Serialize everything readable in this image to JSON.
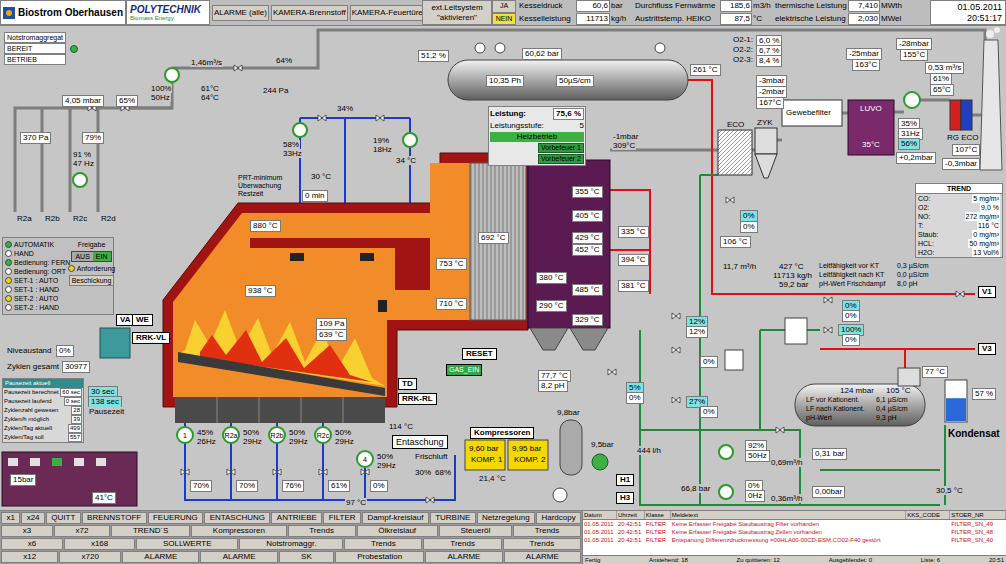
{
  "header": {
    "site": "Biostrom Oberhausen",
    "brand": {
      "name": "POLYTECHNIK",
      "tagline": "Biomass Energy"
    },
    "buttons": [
      "ALARME (alle)",
      "KAMERA-Brennstoff",
      "KAMERA-Feuertüre-1"
    ],
    "ext": {
      "label": "ext.Leitsystem",
      "action": "\"aktivieren\"",
      "options": [
        {
          "label": "JA",
          "selected": false
        },
        {
          "label": "NEIN",
          "selected": true
        }
      ]
    },
    "readings": [
      [
        {
          "label": "Kesseldruck",
          "value": "60,6",
          "unit": "bar"
        },
        {
          "label": "Kesselleistung",
          "value": "11713",
          "unit": "kg/h"
        }
      ],
      [
        {
          "label": "Durchfluss Fernwärme",
          "value": "185,6",
          "unit": "m3/h"
        },
        {
          "label": "Austrittstemp. HEIKO",
          "value": "87,5",
          "unit": "°C"
        }
      ],
      [
        {
          "label": "thermische Leistung",
          "value": "7,410",
          "unit": "MWth"
        },
        {
          "label": "elektrische Leistung",
          "value": "2,030",
          "unit": "MWel"
        }
      ]
    ],
    "date": "01.05.2011",
    "time": "20:51:17"
  },
  "emergency": {
    "title": "Notstromaggregat",
    "states": [
      {
        "label": "BEREIT",
        "on": true
      },
      {
        "label": "BETRIEB",
        "on": false
      }
    ]
  },
  "power": {
    "label": "Leistung:",
    "value": "75,6 %",
    "stage_label": "Leistungsstufe:",
    "stage": "5",
    "mode": "Heizbetrieb",
    "buttons": [
      "Vorbefeuer 1",
      "Vorbefeuer 2"
    ]
  },
  "mode": {
    "options": [
      {
        "label": "AUTOMATIK",
        "selected": true,
        "color": "#2fb34a"
      },
      {
        "label": "HAND",
        "selected": false,
        "color": "#ffffff"
      },
      {
        "label": "Bedienung: FERN",
        "selected": true,
        "color": "#2fb34a"
      },
      {
        "label": "Bedienung: ORT",
        "selected": false,
        "color": "#ffffff"
      },
      {
        "label": "SET-1 : AUTO",
        "selected": true,
        "color": "#e8d52a"
      },
      {
        "label": "SET-1 : HAND",
        "selected": false,
        "color": "#ffffff"
      },
      {
        "label": "SET-2 : AUTO",
        "selected": true,
        "color": "#e8d52a"
      },
      {
        "label": "SET-2 : HAND",
        "selected": false,
        "color": "#ffffff"
      }
    ],
    "release_label": "Freigabe",
    "release": [
      {
        "label": "AUS",
        "selected": false
      },
      {
        "label": "EIN",
        "selected": true
      }
    ],
    "request": {
      "label": "Anforderung",
      "on": true
    },
    "button": "Beschickung"
  },
  "cycles": {
    "title": "Pausezeit aktuell",
    "rows": [
      {
        "label": "Pausezeit berechnet",
        "value": "60 sec"
      },
      {
        "label": "Pausezeit laufend",
        "value": "0 sec"
      },
      {
        "label": "Zyklenzahl gewesen",
        "value": "28"
      },
      {
        "label": "Zyklen/h möglich",
        "value": "39"
      },
      {
        "label": "Zyklen/Tag aktuell",
        "value": "499"
      },
      {
        "label": "Zyklen/Tag soll",
        "value": "557"
      }
    ]
  },
  "trend": {
    "title": "TREND",
    "rows": [
      {
        "label": "CO:",
        "value": "5 mg/m³"
      },
      {
        "label": "O2:",
        "value": "9,0 %"
      },
      {
        "label": "NO:",
        "value": "272 mg/m³"
      },
      {
        "label": "T:",
        "value": "116 °C"
      },
      {
        "label": "Staub:",
        "value": "0 mg/m³"
      },
      {
        "label": "HCL:",
        "value": "50 mg/m³"
      },
      {
        "label": "H2O:",
        "value": "13 Vol%"
      }
    ]
  },
  "condensate": {
    "level": 0.57
  },
  "diagram": {
    "labels": [
      {
        "text": "1,46m³/s",
        "kind": "plain"
      },
      {
        "text": "4,05 mbar",
        "kind": "box"
      },
      {
        "text": "65%",
        "kind": "box"
      },
      {
        "text": "370 Pa",
        "kind": "box"
      },
      {
        "text": "79%",
        "kind": "box"
      },
      {
        "text": "91 %",
        "kind": "plain"
      },
      {
        "text": "47 Hz",
        "kind": "plain"
      },
      {
        "text": "100%",
        "kind": "plain"
      },
      {
        "text": "50Hz",
        "kind": "plain"
      },
      {
        "text": "61°C",
        "kind": "plain"
      },
      {
        "text": "64°C",
        "kind": "plain"
      },
      {
        "text": "64%",
        "kind": "plain"
      },
      {
        "text": "244 Pa",
        "kind": "plain"
      },
      {
        "text": "34%",
        "kind": "plain"
      },
      {
        "text": "19%",
        "kind": "plain"
      },
      {
        "text": "18Hz",
        "kind": "plain"
      },
      {
        "text": "34 °C",
        "kind": "plain"
      },
      {
        "text": "58%",
        "kind": "plain"
      },
      {
        "text": "33Hz",
        "kind": "plain"
      },
      {
        "text": "30 °C",
        "kind": "plain"
      },
      {
        "text": "R2a",
        "kind": "plain"
      },
      {
        "text": "R2b",
        "kind": "plain"
      },
      {
        "text": "R2c",
        "kind": "plain"
      },
      {
        "text": "R2d",
        "kind": "plain"
      },
      {
        "text": "PRT-minimum Überwachung Restzeit",
        "kind": "note"
      },
      {
        "text": "0 min",
        "kind": "box"
      },
      {
        "text": "880 °C",
        "kind": "box"
      },
      {
        "text": "938 °C",
        "kind": "box"
      },
      {
        "text": "753 °C",
        "kind": "box"
      },
      {
        "text": "692 °C",
        "kind": "box"
      },
      {
        "text": "710 °C",
        "kind": "box"
      },
      {
        "text": "109 Pa",
        "kind": "box"
      },
      {
        "text": "639 °C",
        "kind": "box"
      },
      {
        "text": "51,2 %",
        "kind": "box"
      },
      {
        "text": "60,62 bar",
        "kind": "box"
      },
      {
        "text": "10,35 Ph",
        "kind": "box"
      },
      {
        "text": "50µS/cm",
        "kind": "box"
      },
      {
        "text": "-1mbar",
        "kind": "plain"
      },
      {
        "text": "309°C",
        "kind": "plain"
      },
      {
        "text": "355 °C",
        "kind": "box"
      },
      {
        "text": "405 °C",
        "kind": "box"
      },
      {
        "text": "429 °C",
        "kind": "box"
      },
      {
        "text": "452 °C",
        "kind": "box"
      },
      {
        "text": "380 °C",
        "kind": "box"
      },
      {
        "text": "485 °C",
        "kind": "box"
      },
      {
        "text": "290 °C",
        "kind": "box"
      },
      {
        "text": "329 °C",
        "kind": "box"
      },
      {
        "text": "335 °C",
        "kind": "box"
      },
      {
        "text": "394 °C",
        "kind": "box"
      },
      {
        "text": "381 °C",
        "kind": "box"
      },
      {
        "text": "261 °C",
        "kind": "box"
      },
      {
        "text": "106 °C",
        "kind": "box"
      },
      {
        "text": "11,7 m³/h",
        "kind": "plain"
      },
      {
        "text": "0%",
        "kind": "cyan"
      },
      {
        "text": "0%",
        "kind": "box"
      },
      {
        "text": "427 °C",
        "kind": "plain"
      },
      {
        "text": "11713 kg/h",
        "kind": "plain"
      },
      {
        "text": "59,2 bar",
        "kind": "plain"
      },
      {
        "text": "O2-1:",
        "kind": "plain"
      },
      {
        "text": "6,0 %",
        "kind": "box"
      },
      {
        "text": "O2-2:",
        "kind": "plain"
      },
      {
        "text": "6,7 %",
        "kind": "box"
      },
      {
        "text": "O2-3:",
        "kind": "plain"
      },
      {
        "text": "8,4 %",
        "kind": "box"
      },
      {
        "text": "-3mbar",
        "kind": "box"
      },
      {
        "text": "-2mbar",
        "kind": "box"
      },
      {
        "text": "167°C",
        "kind": "box"
      },
      {
        "text": "ECO",
        "kind": "plain"
      },
      {
        "text": "ZYK",
        "kind": "plain"
      },
      {
        "text": "Gewebefilter",
        "kind": "wbox"
      },
      {
        "text": "LUVO",
        "kind": "inv"
      },
      {
        "text": "-25mbar",
        "kind": "box"
      },
      {
        "text": "163°C",
        "kind": "box"
      },
      {
        "text": "-28mbar",
        "kind": "box"
      },
      {
        "text": "155°C",
        "kind": "box"
      },
      {
        "text": "0,53 m³/s",
        "kind": "box"
      },
      {
        "text": "61%",
        "kind": "box"
      },
      {
        "text": "65°C",
        "kind": "box"
      },
      {
        "text": "35%",
        "kind": "box"
      },
      {
        "text": "31Hz",
        "kind": "box"
      },
      {
        "text": "56%",
        "kind": "cyan"
      },
      {
        "text": "35°C",
        "kind": "inv"
      },
      {
        "text": "RG ECO",
        "kind": "plain"
      },
      {
        "text": "+0,2mbar",
        "kind": "box"
      },
      {
        "text": "107°C",
        "kind": "box"
      },
      {
        "text": "-0,3mbar",
        "kind": "box"
      },
      {
        "text": "Leitfähigkeit vor KT",
        "kind": "small"
      },
      {
        "text": "0,3 µS/cm",
        "kind": "small"
      },
      {
        "text": "Leitfähigkeit nach KT",
        "kind": "small"
      },
      {
        "text": "0,0 µS/cm",
        "kind": "small"
      },
      {
        "text": "pH-Wert Frischdampf",
        "kind": "small"
      },
      {
        "text": "8,0 pH",
        "kind": "small"
      },
      {
        "text": "V1",
        "kind": "tag"
      },
      {
        "text": "V3",
        "kind": "tag"
      },
      {
        "text": "0%",
        "kind": "cyan"
      },
      {
        "text": "0%",
        "kind": "box"
      },
      {
        "text": "100%",
        "kind": "cyan"
      },
      {
        "text": "0%",
        "kind": "box"
      },
      {
        "text": "12%",
        "kind": "cyan"
      },
      {
        "text": "12%",
        "kind": "box"
      },
      {
        "text": "0%",
        "kind": "box"
      },
      {
        "text": "27%",
        "kind": "cyan"
      },
      {
        "text": "0%",
        "kind": "box"
      },
      {
        "text": "5%",
        "kind": "cyan"
      },
      {
        "text": "0%",
        "kind": "box"
      },
      {
        "text": "124 mbar",
        "kind": "onshape"
      },
      {
        "text": "105 °C",
        "kind": "onshape"
      },
      {
        "text": "LF vor Kationent.",
        "kind": "onsmall"
      },
      {
        "text": "6,1 µS/cm",
        "kind": "onsmall"
      },
      {
        "text": "LF nach Kationent.",
        "kind": "onsmall"
      },
      {
        "text": "0,4 µS/cm",
        "kind": "onsmall"
      },
      {
        "text": "pH-Wert",
        "kind": "onsmall"
      },
      {
        "text": "9,3 pH",
        "kind": "onsmall"
      },
      {
        "text": "77 °C",
        "kind": "box"
      },
      {
        "text": "57 %",
        "kind": "box"
      },
      {
        "text": "Kondensat",
        "kind": "big"
      },
      {
        "text": "30,5 °C",
        "kind": "plain"
      },
      {
        "text": "92%",
        "kind": "box"
      },
      {
        "text": "50Hz",
        "kind": "box"
      },
      {
        "text": "0,69m³/h",
        "kind": "plain"
      },
      {
        "text": "0,31 bar",
        "kind": "box"
      },
      {
        "text": "0%",
        "kind": "box"
      },
      {
        "text": "0Hz",
        "kind": "box"
      },
      {
        "text": "0,36m³/h",
        "kind": "plain"
      },
      {
        "text": "0,00bar",
        "kind": "box"
      },
      {
        "text": "H1",
        "kind": "tag"
      },
      {
        "text": "H3",
        "kind": "tag"
      },
      {
        "text": "444 l/h",
        "kind": "plain"
      },
      {
        "text": "66,8 bar",
        "kind": "plain"
      },
      {
        "text": "Kompressoren",
        "kind": "tag"
      },
      {
        "text": "9,60 bar",
        "kind": "yellow"
      },
      {
        "text": "KOMP. 1",
        "kind": "yellow"
      },
      {
        "text": "9,95 bar",
        "kind": "yellow"
      },
      {
        "text": "KOMP. 2",
        "kind": "yellow"
      },
      {
        "text": "9,8bar",
        "kind": "plain"
      },
      {
        "text": "9,5bar",
        "kind": "plain"
      },
      {
        "text": "21,4 °C",
        "kind": "plain"
      },
      {
        "text": "77,7 °C",
        "kind": "box"
      },
      {
        "text": "8,2 pH",
        "kind": "box"
      },
      {
        "text": "Entaschung",
        "kind": "bigtag"
      },
      {
        "text": "Frischluft",
        "kind": "plain"
      },
      {
        "text": "30%",
        "kind": "plain"
      },
      {
        "text": "68%",
        "kind": "plain"
      },
      {
        "text": "114 °C",
        "kind": "plain"
      },
      {
        "text": "97 °C",
        "kind": "plain"
      },
      {
        "text": "TD",
        "kind": "tag"
      },
      {
        "text": "RRK-RL",
        "kind": "tag"
      },
      {
        "text": "RESET",
        "kind": "tag"
      },
      {
        "text": "GAS_EIN",
        "kind": "green"
      },
      {
        "text": "1",
        "kind": "circle"
      },
      {
        "text": "45%",
        "kind": "plain"
      },
      {
        "text": "26Hz",
        "kind": "plain"
      },
      {
        "text": "R2a",
        "kind": "circle"
      },
      {
        "text": "50%",
        "kind": "plain"
      },
      {
        "text": "29Hz",
        "kind": "plain"
      },
      {
        "text": "R2b",
        "kind": "circle"
      },
      {
        "text": "50%",
        "kind": "plain"
      },
      {
        "text": "29Hz",
        "kind": "plain"
      },
      {
        "text": "R2c",
        "kind": "circle"
      },
      {
        "text": "50%",
        "kind": "plain"
      },
      {
        "text": "29Hz",
        "kind": "plain"
      },
      {
        "text": "4",
        "kind": "circle"
      },
      {
        "text": "50%",
        "kind": "plain"
      },
      {
        "text": "29Hz",
        "kind": "plain"
      },
      {
        "text": "70%",
        "kind": "box"
      },
      {
        "text": "70%",
        "kind": "box"
      },
      {
        "text": "76%",
        "kind": "box"
      },
      {
        "text": "61%",
        "kind": "box"
      },
      {
        "text": "0%",
        "kind": "box"
      },
      {
        "text": "Niveaustand",
        "kind": "plain"
      },
      {
        "text": "0%",
        "kind": "box"
      },
      {
        "text": "Zyklen gesamt",
        "kind": "plain"
      },
      {
        "text": "30977",
        "kind": "box"
      },
      {
        "text": "RRK-VL",
        "kind": "tag"
      },
      {
        "text": "VA",
        "kind": "tag"
      },
      {
        "text": "WE",
        "kind": "tag"
      },
      {
        "text": "30 sec",
        "kind": "cyan"
      },
      {
        "text": "138 sec",
        "kind": "cyan"
      },
      {
        "text": "Pausezeit",
        "kind": "plain"
      },
      {
        "text": "15bar",
        "kind": "box"
      },
      {
        "text": "41°C",
        "kind": "box"
      }
    ]
  },
  "nav": {
    "rows": [
      [
        "x1",
        "x24",
        "QUITT",
        "BRENNSTOFF",
        "FEUERUNG",
        "ENTASCHUNG",
        "ANTRIEBE",
        "FILTER",
        "Dampf-kreislauf",
        "TURBINE",
        "Netzregelung",
        "Hardcopy"
      ],
      [
        "x3",
        "x72",
        "TREND´S",
        "Kompressoren",
        "Trends",
        "Ölkreislauf",
        "Steueröl",
        "Trends"
      ],
      [
        "x6",
        "x168",
        "SOLLWERTE",
        "Notstromaggr.",
        "Trends",
        "Trends",
        "Trends"
      ],
      [
        "x12",
        "x720",
        "ALARME",
        "ALARME",
        "SK",
        "Probestation",
        "ALARME",
        "ALARME"
      ]
    ]
  },
  "alarms": {
    "columns": [
      "Datum",
      "Uhrzeit",
      "Klasse",
      "Meldetext",
      "KKS_CODE",
      "STOER_NR"
    ],
    "rows": [
      [
        "01.05.2011",
        "20:42:51",
        "FILTER",
        "Keine Erfasser Freigabe Staubaustrag Filter vorhanden",
        "",
        "FILTER_SN_49"
      ],
      [
        "01.05.2011",
        "20:42:51",
        "FILTER",
        "Keine Erfasser Freigabe Staubaustrag Zellen vorhanden",
        "",
        "FILTER_SN_48"
      ],
      [
        "01.05.2011",
        "20:42:51",
        "FILTER",
        "Entspanung Differenzdruckmessung =00HLA00-00CD-ESM.CO02-F40 gestört",
        "",
        "FILTER_SN_40"
      ]
    ],
    "status": [
      "Fertig",
      "Anstehend: 18",
      "Zu quittieren: 12",
      "Ausgeblendet: 0",
      "Liste: 6",
      "20:51"
    ]
  }
}
